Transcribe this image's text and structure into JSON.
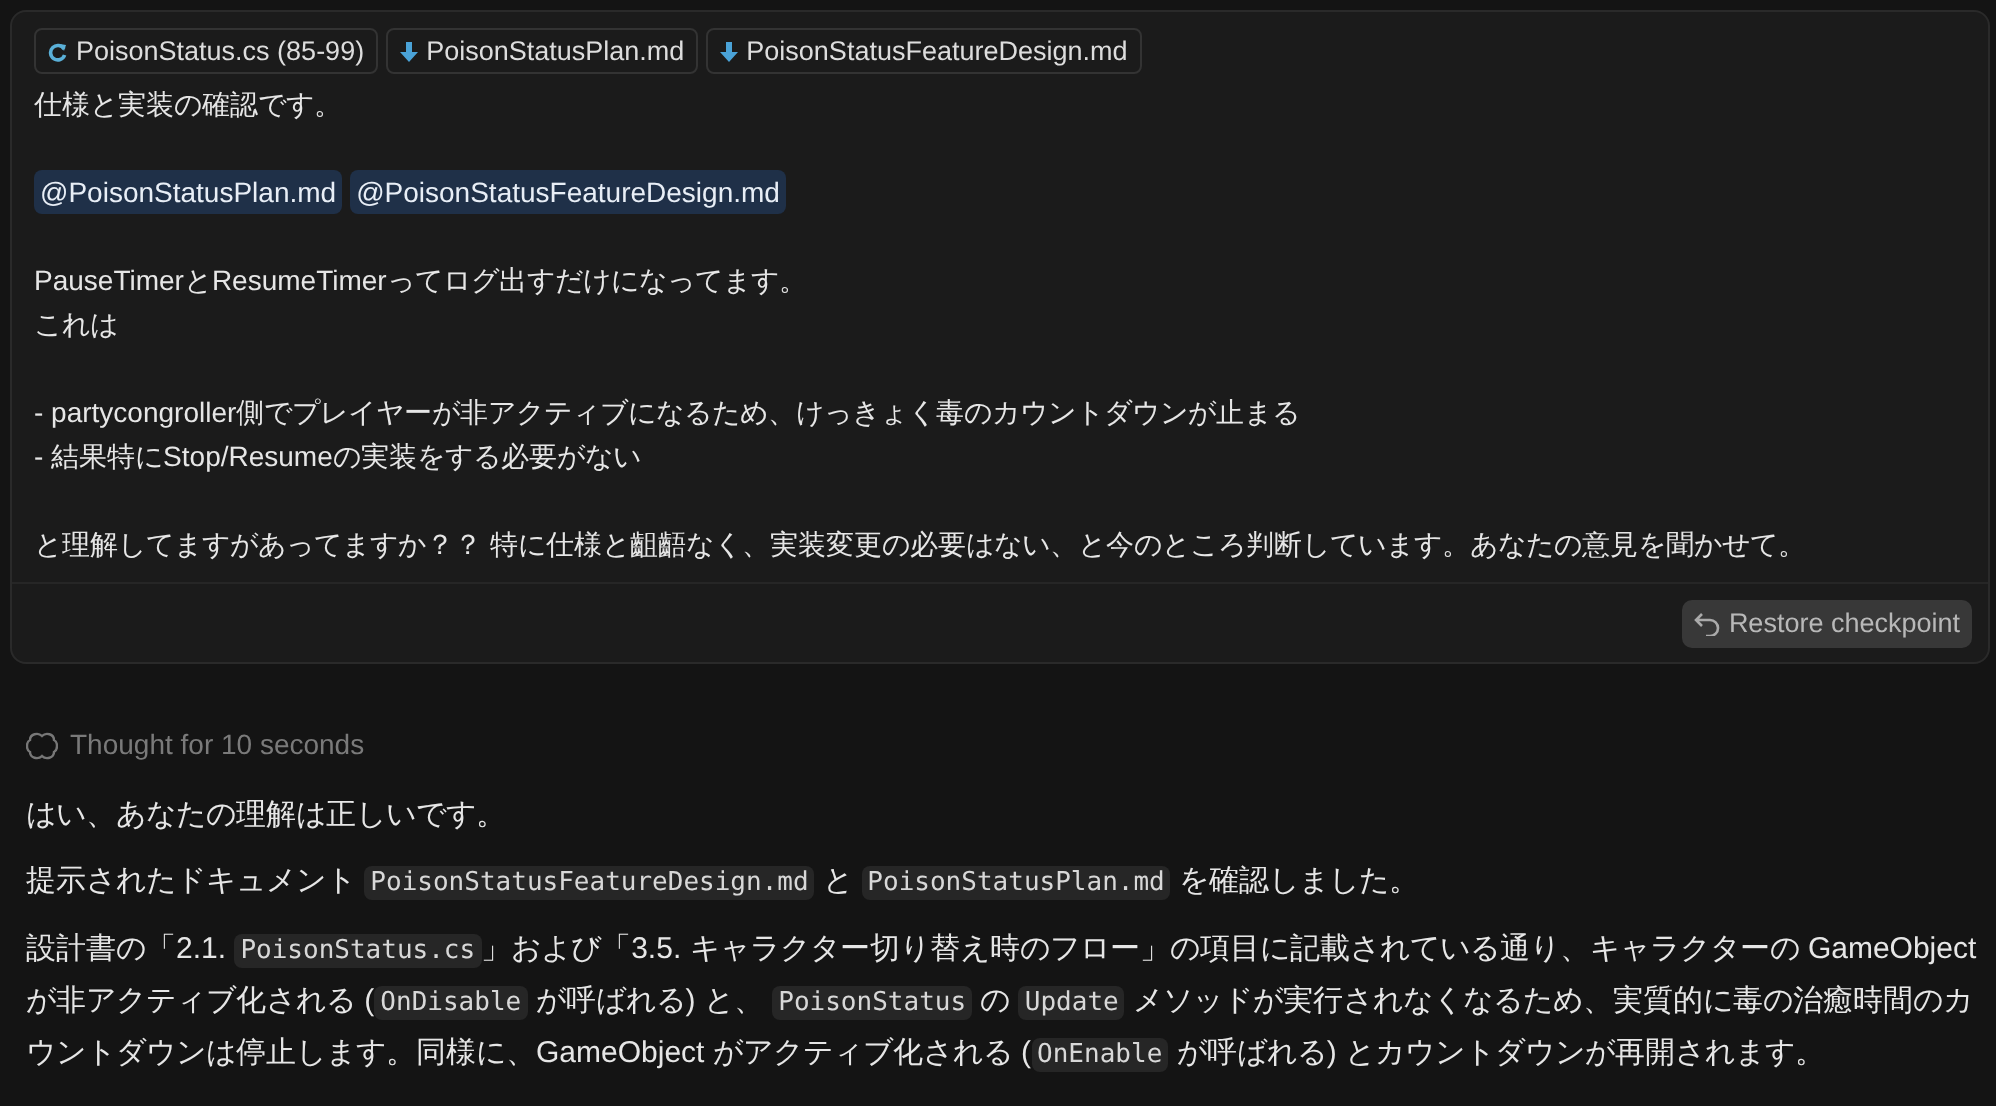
{
  "user_message": {
    "context_chips": [
      {
        "kind": "cs",
        "label": "PoisonStatus.cs (85-99)"
      },
      {
        "kind": "md",
        "label": "PoisonStatusPlan.md"
      },
      {
        "kind": "md",
        "label": "PoisonStatusFeatureDesign.md"
      }
    ],
    "blocks": [
      {
        "kind": "text",
        "text": "仕様と実装の確認です。"
      },
      {
        "kind": "blank"
      },
      {
        "kind": "mentions",
        "items": [
          "@PoisonStatusPlan.md",
          "@PoisonStatusFeatureDesign.md"
        ]
      },
      {
        "kind": "blank"
      },
      {
        "kind": "text",
        "text": "PauseTimerとResumeTimerってログ出すだけになってます。"
      },
      {
        "kind": "text",
        "text": "これは"
      },
      {
        "kind": "blank"
      },
      {
        "kind": "text",
        "text": "- partycongroller側でプレイヤーが非アクティブになるため、けっきょく毒のカウントダウンが止まる"
      },
      {
        "kind": "text",
        "text": "- 結果特にStop/Resumeの実装をする必要がない"
      },
      {
        "kind": "blank"
      },
      {
        "kind": "text",
        "text": "と理解してますがあってますか？？ 特に仕様と齟齬なく、実装変更の必要はない、と今のところ判断しています。あなたの意見を聞かせて。"
      }
    ],
    "restore_button": "Restore checkpoint"
  },
  "thought": "Thought for 10 seconds",
  "response": [
    [
      {
        "kind": "text",
        "text": "はい、あなたの理解は正しいです。"
      }
    ],
    [
      {
        "kind": "text",
        "text": "提示されたドキュメント "
      },
      {
        "kind": "code",
        "text": "PoisonStatusFeatureDesign.md"
      },
      {
        "kind": "text",
        "text": " と "
      },
      {
        "kind": "code",
        "text": "PoisonStatusPlan.md"
      },
      {
        "kind": "text",
        "text": " を確認しました。"
      }
    ],
    [
      {
        "kind": "text",
        "text": "設計書の「2.1. "
      },
      {
        "kind": "code",
        "text": "PoisonStatus.cs"
      },
      {
        "kind": "text",
        "text": "」および「3.5. キャラクター切り替え時のフロー」の項目に記載されている通り、キャラクターの GameObject が非アクティブ化される ("
      },
      {
        "kind": "code",
        "text": "OnDisable"
      },
      {
        "kind": "text",
        "text": " が呼ばれる) と、 "
      },
      {
        "kind": "code",
        "text": "PoisonStatus"
      },
      {
        "kind": "text",
        "text": " の "
      },
      {
        "kind": "code",
        "text": "Update"
      },
      {
        "kind": "text",
        "text": " メソッドが実行されなくなるため、実質的に毒の治癒時間のカウントダウンは停止します。同様に、GameObject がアクティブ化される ("
      },
      {
        "kind": "code",
        "text": "OnEnable"
      },
      {
        "kind": "text",
        "text": " が呼ばれる) とカウントダウンが再開されます。"
      }
    ]
  ]
}
